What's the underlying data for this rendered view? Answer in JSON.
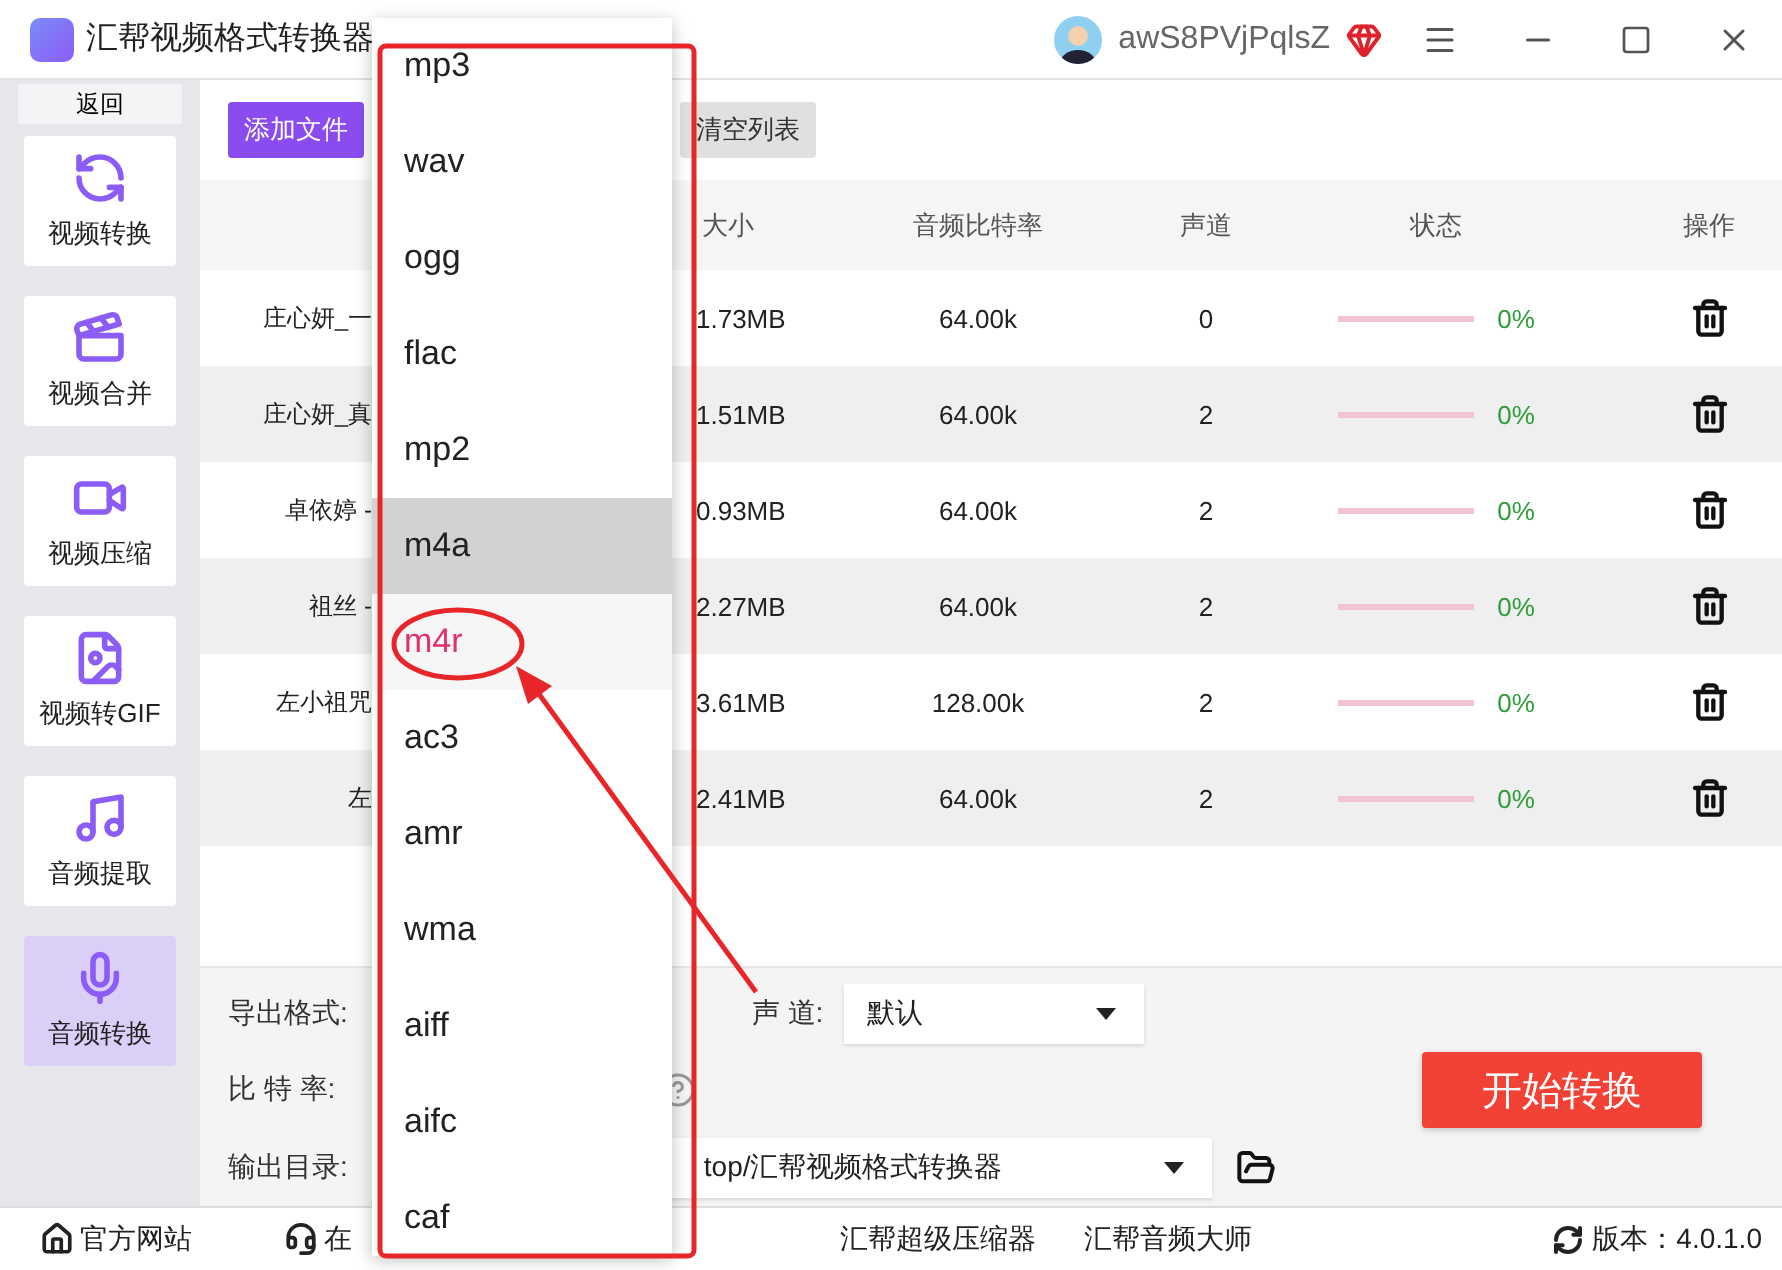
{
  "window": {
    "title": "汇帮视频格式转换器",
    "user": "awS8PVjPqlsZ"
  },
  "sidebar": {
    "back": "返回",
    "items": [
      {
        "label": "视频转换",
        "kind": "convert",
        "selected": false
      },
      {
        "label": "视频合并",
        "kind": "merge",
        "selected": false
      },
      {
        "label": "视频压缩",
        "kind": "compress",
        "selected": false
      },
      {
        "label": "视频转GIF",
        "kind": "gif",
        "selected": false
      },
      {
        "label": "音频提取",
        "kind": "music",
        "selected": false
      },
      {
        "label": "音频转换",
        "kind": "mic",
        "selected": true
      }
    ]
  },
  "toolbar": {
    "buttons": [
      {
        "label": "添加文件",
        "kind": "primary"
      },
      {
        "label": "清空列表",
        "kind": "secondary"
      }
    ]
  },
  "table": {
    "columns": [
      "大小",
      "音频比特率",
      "声道",
      "状态",
      "操作"
    ],
    "rows": [
      {
        "name": "庄心妍_一",
        "size": "1.73MB",
        "bitrate": "64.00k",
        "channels": "0",
        "level": 0,
        "progress": "0%"
      },
      {
        "name": "庄心妍_真",
        "size": "1.51MB",
        "bitrate": "64.00k",
        "channels": "2",
        "level": 0,
        "progress": "0%"
      },
      {
        "name": "卓依婷 -",
        "size": "0.93MB",
        "bitrate": "64.00k",
        "channels": "2",
        "level": 0,
        "progress": "0%"
      },
      {
        "name": "祖丝 -",
        "size": "2.27MB",
        "bitrate": "64.00k",
        "channels": "2",
        "level": 0,
        "progress": "0%"
      },
      {
        "name": "左小祖咒",
        "size": "3.61MB",
        "bitrate": "128.00k",
        "channels": "2",
        "level": 0,
        "progress": "0%"
      },
      {
        "name": "左",
        "size": "2.41MB",
        "bitrate": "64.00k",
        "channels": "2",
        "level": 0,
        "progress": "0%"
      }
    ]
  },
  "settings": {
    "export_format_label": "导出格式:",
    "channel_label": "声 道:",
    "channel_value": "默认",
    "bitrate_label": "比 特 率:",
    "output_label": "输出目录:",
    "output_value": "top/汇帮视频格式转换器",
    "start_button": "开始转换"
  },
  "status_bar": {
    "links": [
      {
        "label": "官方网站",
        "kind": "home"
      },
      {
        "label": "在",
        "kind": "support"
      },
      {
        "label": "汇帮超级压缩器",
        "kind": "plain"
      },
      {
        "label": "汇帮音频大师",
        "kind": "plain"
      }
    ],
    "version": "版本：4.0.1.0"
  },
  "dropdown": {
    "options": [
      {
        "label": "mp3",
        "selected": false,
        "hovered": false
      },
      {
        "label": "wav",
        "selected": false,
        "hovered": false
      },
      {
        "label": "ogg",
        "selected": false,
        "hovered": false
      },
      {
        "label": "flac",
        "selected": false,
        "hovered": false
      },
      {
        "label": "mp2",
        "selected": false,
        "hovered": false
      },
      {
        "label": "m4a",
        "selected": true,
        "hovered": false
      },
      {
        "label": "m4r",
        "selected": false,
        "hovered": true
      },
      {
        "label": "ac3",
        "selected": false,
        "hovered": false
      },
      {
        "label": "amr",
        "selected": false,
        "hovered": false
      },
      {
        "label": "wma",
        "selected": false,
        "hovered": false
      },
      {
        "label": "aiff",
        "selected": false,
        "hovered": false
      },
      {
        "label": "aifc",
        "selected": false,
        "hovered": false
      },
      {
        "label": "caf",
        "selected": false,
        "hovered": false
      }
    ]
  }
}
